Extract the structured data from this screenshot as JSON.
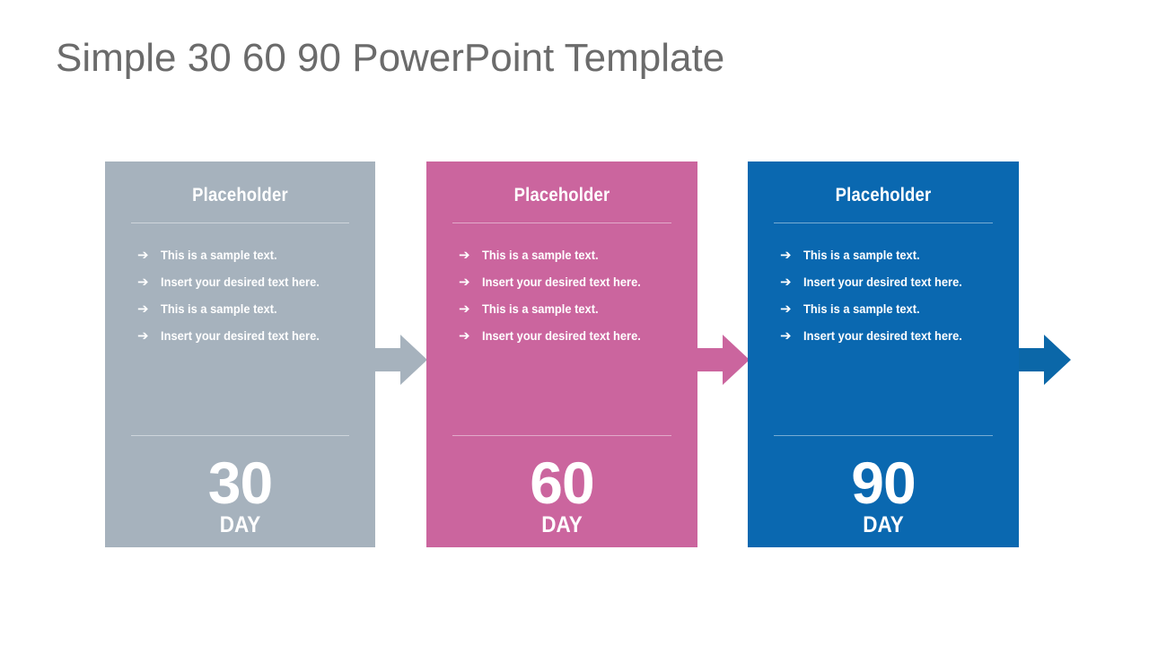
{
  "page": {
    "title": "Simple 30 60 90 PowerPoint Template",
    "background": "#ffffff",
    "title_color": "#6b6b6b"
  },
  "cards": [
    {
      "id": "card-30",
      "heading": "Placeholder",
      "color": "#a6b2bd",
      "number": "30",
      "day_label": "DAY",
      "bullet_marker": "➔",
      "bullets": [
        "This is a sample text.",
        "Insert your desired  text here.",
        "This is a sample text.",
        "Insert your desired  text here."
      ]
    },
    {
      "id": "card-60",
      "heading": "Placeholder",
      "color": "#cb659e",
      "number": "60",
      "day_label": "DAY",
      "bullet_marker": "➔",
      "bullets": [
        "This is a sample text.",
        "Insert your desired  text here.",
        "This is a sample text.",
        "Insert your desired  text here."
      ]
    },
    {
      "id": "card-90",
      "heading": "Placeholder",
      "color": "#0a68b0",
      "number": "90",
      "day_label": "DAY",
      "bullet_marker": "➔",
      "bullets": [
        "This is a sample text.",
        "Insert your desired  text here.",
        "This is a sample text.",
        "Insert your desired  text here."
      ]
    }
  ],
  "arrows": [
    {
      "id": "arrow-30-to-60",
      "color": "#a6b2bd"
    },
    {
      "id": "arrow-60-to-90",
      "color": "#cb659e"
    },
    {
      "id": "arrow-90-end",
      "color": "#0b67a8"
    }
  ]
}
